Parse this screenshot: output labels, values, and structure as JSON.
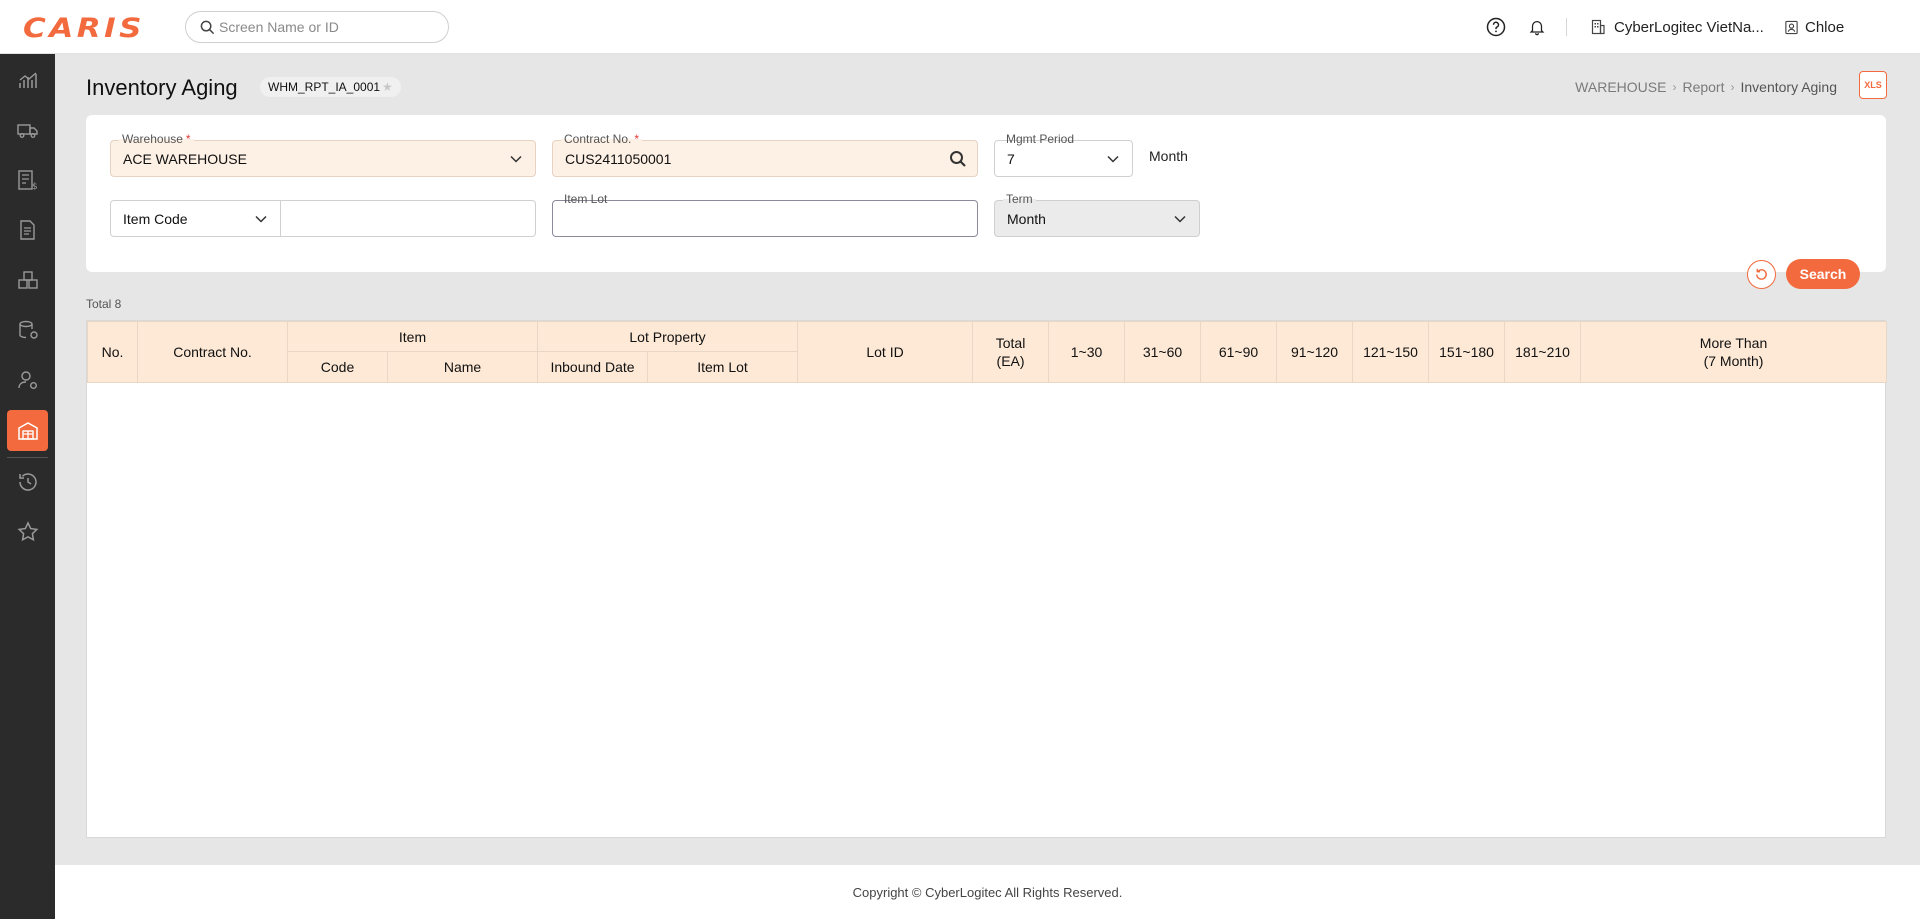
{
  "app": {
    "logo": "CARIS"
  },
  "header": {
    "search_placeholder": "Screen Name or ID",
    "org_name": "CyberLogitec VietNa...",
    "user_name": "Chloe"
  },
  "sidebar": {
    "items": [
      {
        "icon": "analytics-icon"
      },
      {
        "icon": "truck-icon"
      },
      {
        "icon": "billing-icon"
      },
      {
        "icon": "document-icon"
      },
      {
        "icon": "boxes-icon"
      },
      {
        "icon": "database-settings-icon"
      },
      {
        "icon": "user-settings-icon"
      },
      {
        "icon": "warehouse-icon",
        "active": true
      },
      {
        "icon": "history-icon"
      },
      {
        "icon": "star-icon"
      }
    ]
  },
  "page": {
    "title": "Inventory Aging",
    "screen_id": "WHM_RPT_IA_0001",
    "breadcrumb": [
      "WAREHOUSE",
      "Report",
      "Inventory Aging"
    ],
    "xls_label": "XLS"
  },
  "filters": {
    "warehouse": {
      "label": "Warehouse",
      "value": "ACE WAREHOUSE"
    },
    "contract": {
      "label": "Contract No.",
      "value": "CUS2411050001"
    },
    "mgmt_period": {
      "label": "Mgmt Period",
      "value": "7",
      "unit": "Month"
    },
    "item_type": {
      "value": "Item Code"
    },
    "item_value": {
      "value": ""
    },
    "item_lot": {
      "label": "Item Lot",
      "value": ""
    },
    "term": {
      "label": "Term",
      "value": "Month"
    },
    "search_label": "Search"
  },
  "grid": {
    "total_label": "Total 8",
    "headers": {
      "no": "No.",
      "contract_no": "Contract No.",
      "item": "Item",
      "code": "Code",
      "name": "Name",
      "lot_property": "Lot Property",
      "inbound_date": "Inbound Date",
      "item_lot": "Item Lot",
      "lot_id": "Lot ID",
      "total_line1": "Total",
      "total_line2": "(EA)",
      "b1": "1~30",
      "b2": "31~60",
      "b3": "61~90",
      "b4": "91~120",
      "b5": "121~150",
      "b6": "151~180",
      "b7": "181~210",
      "more_line1": "More Than",
      "more_line2": "(7 Month)"
    },
    "rows": []
  },
  "footer": {
    "copyright": "Copyright © CyberLogitec All Rights Reserved."
  },
  "colors": {
    "accent": "#f26a3d",
    "header_bg": "#fde9d6",
    "sidebar_bg": "#2b2b2b"
  }
}
